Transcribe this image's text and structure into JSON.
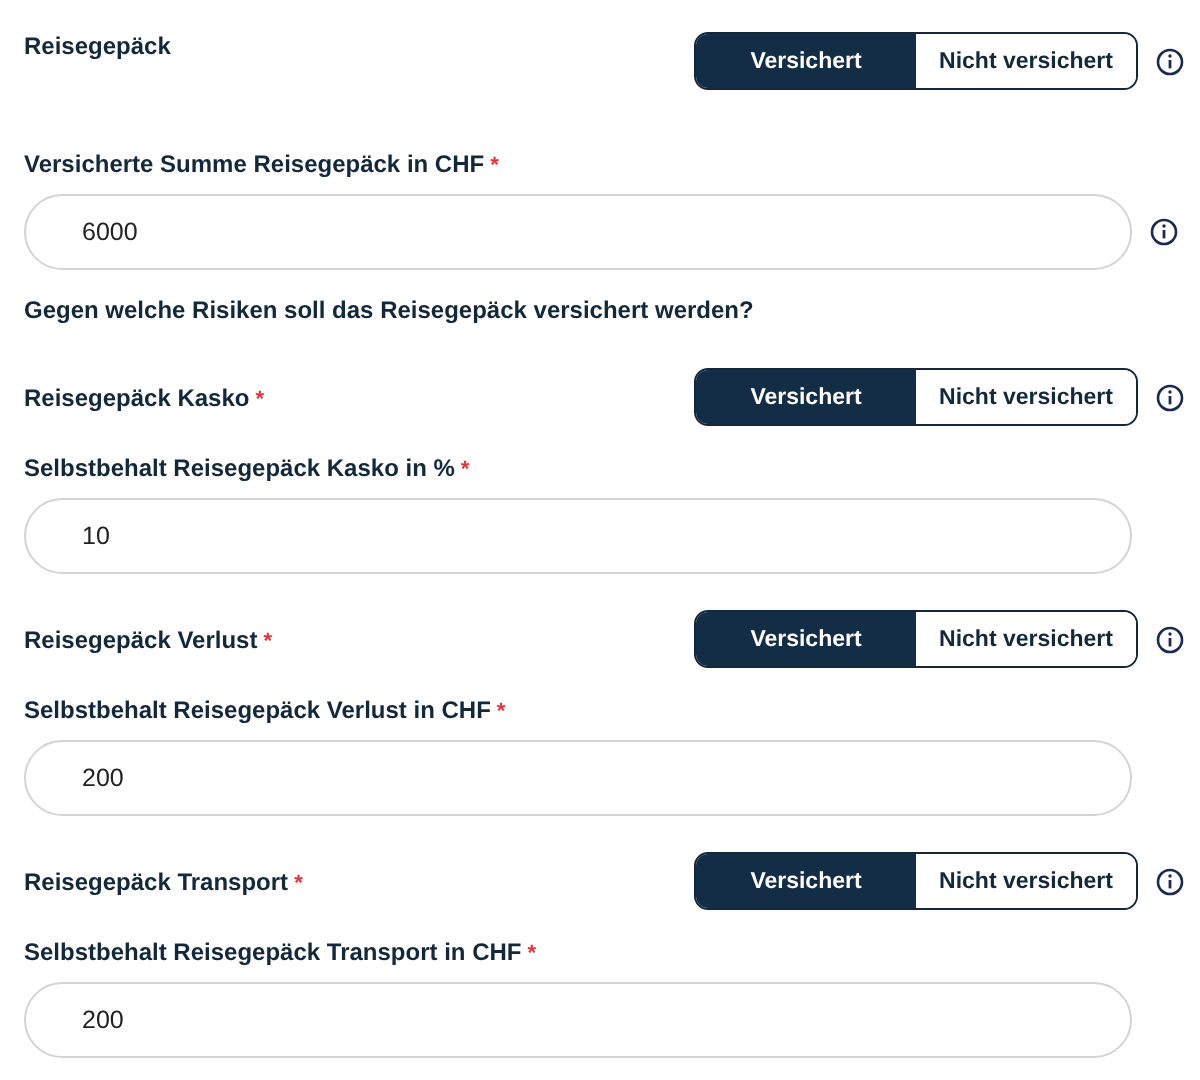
{
  "items": [
    {
      "kind": "toggle",
      "label": "Reisegepäck",
      "info": true,
      "options": [
        {
          "label": "Versichert",
          "selected": true
        },
        {
          "label": "Nicht versichert",
          "selected": false
        }
      ]
    },
    {
      "kind": "input",
      "label": "Versicherte Summe Reisegepäck in CHF",
      "required": "*",
      "value": "6000",
      "info": true
    },
    {
      "kind": "heading",
      "label": "Gegen welche Risiken soll das Reisegepäck versichert werden?"
    },
    {
      "kind": "toggle",
      "label": "Reisegepäck Kasko",
      "required": "*",
      "info": true,
      "options": [
        {
          "label": "Versichert",
          "selected": true
        },
        {
          "label": "Nicht versichert",
          "selected": false
        }
      ]
    },
    {
      "kind": "input",
      "label": "Selbstbehalt Reisegepäck Kasko in %",
      "required": "*",
      "value": "10",
      "info": false
    },
    {
      "kind": "toggle",
      "label": "Reisegepäck Verlust",
      "required": "*",
      "info": true,
      "options": [
        {
          "label": "Versichert",
          "selected": true
        },
        {
          "label": "Nicht versichert",
          "selected": false
        }
      ]
    },
    {
      "kind": "input",
      "label": "Selbstbehalt Reisegepäck Verlust in CHF",
      "required": "*",
      "value": "200",
      "info": false
    },
    {
      "kind": "toggle",
      "label": "Reisegepäck Transport",
      "required": "*",
      "info": true,
      "options": [
        {
          "label": "Versichert",
          "selected": true
        },
        {
          "label": "Nicht versichert",
          "selected": false
        }
      ]
    },
    {
      "kind": "input",
      "label": "Selbstbehalt Reisegepäck Transport in CHF",
      "required": "*",
      "value": "200",
      "info": false
    }
  ]
}
